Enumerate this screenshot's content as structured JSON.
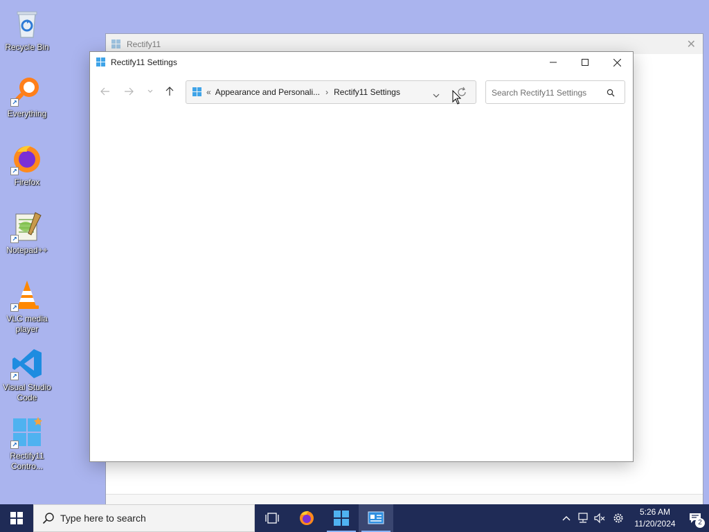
{
  "desktop": {
    "icons": [
      {
        "label": "Recycle Bin"
      },
      {
        "label": "Everything"
      },
      {
        "label": "Firefox"
      },
      {
        "label": "Notepad++"
      },
      {
        "label": "VLC media player"
      },
      {
        "label": "Visual Studio Code"
      },
      {
        "label": "Rectify11 Contro..."
      }
    ]
  },
  "back_window": {
    "title": "Rectify11"
  },
  "window": {
    "title": "Rectify11 Settings",
    "breadcrumb": {
      "overflow": "«",
      "item1": "Appearance and Personali...",
      "separator": "›",
      "item2": "Rectify11 Settings"
    },
    "search_placeholder": "Search Rectify11 Settings"
  },
  "taskbar": {
    "search_placeholder": "Type here to search",
    "clock": {
      "time": "5:26 AM",
      "date": "11/20/2024"
    },
    "notification_count": "2"
  },
  "colors": {
    "desktop_bg": "#aab4ee",
    "taskbar_bg": "#1f2b56",
    "accent": "#0078d4"
  }
}
